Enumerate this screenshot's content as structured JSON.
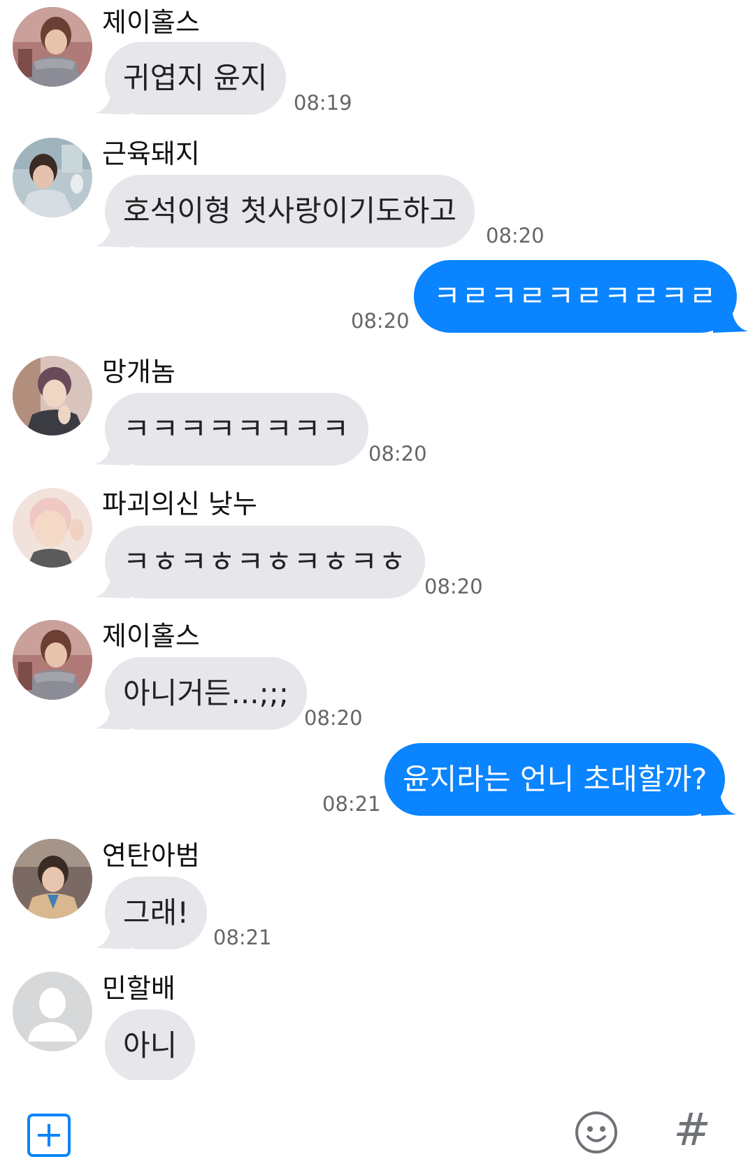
{
  "messages": [
    {
      "sender": "제이홀스",
      "text": "귀엽지 윤지",
      "time": "08:19",
      "avatar": "avatar-jhope-icon"
    },
    {
      "sender": "근육돼지",
      "text": "호석이형 첫사랑이기도하고",
      "time": "08:20",
      "avatar": "avatar-jungkook-icon"
    },
    {
      "text": "ㅋㄹㅋㄹㅋㄹㅋㄹㅋㄹ",
      "time": "08:20"
    },
    {
      "sender": "망개놈",
      "text": "ㅋㅋㅋㅋㅋㅋㅋㅋ",
      "time": "08:20",
      "avatar": "avatar-jimin-icon"
    },
    {
      "sender": "파괴의신 낮누",
      "text": "ㅋㅎㅋㅎㅋㅎㅋㅎㅋㅎ",
      "time": "08:20",
      "avatar": "avatar-namjoon-icon"
    },
    {
      "sender": "제이홀스",
      "text": "아니거든...;;;",
      "time": "08:20",
      "avatar": "avatar-jhope-icon"
    },
    {
      "text": "윤지라는 언니 초대할까?",
      "time": "08:21"
    },
    {
      "sender": "연탄아범",
      "text": "그래!",
      "time": "08:21",
      "avatar": "avatar-taehyung-icon"
    },
    {
      "sender": "민할배",
      "text": "아니",
      "avatar": "default-profile-icon"
    }
  ],
  "colors": {
    "incoming_bubble": "#e6e6eb",
    "outgoing_bubble": "#0a84ff",
    "timestamp": "#666666",
    "accent": "#0a84ff"
  },
  "input_bar": {
    "add_icon": "plus-square-icon",
    "emoji_icon": "smiley-icon",
    "hash_label": "#"
  }
}
